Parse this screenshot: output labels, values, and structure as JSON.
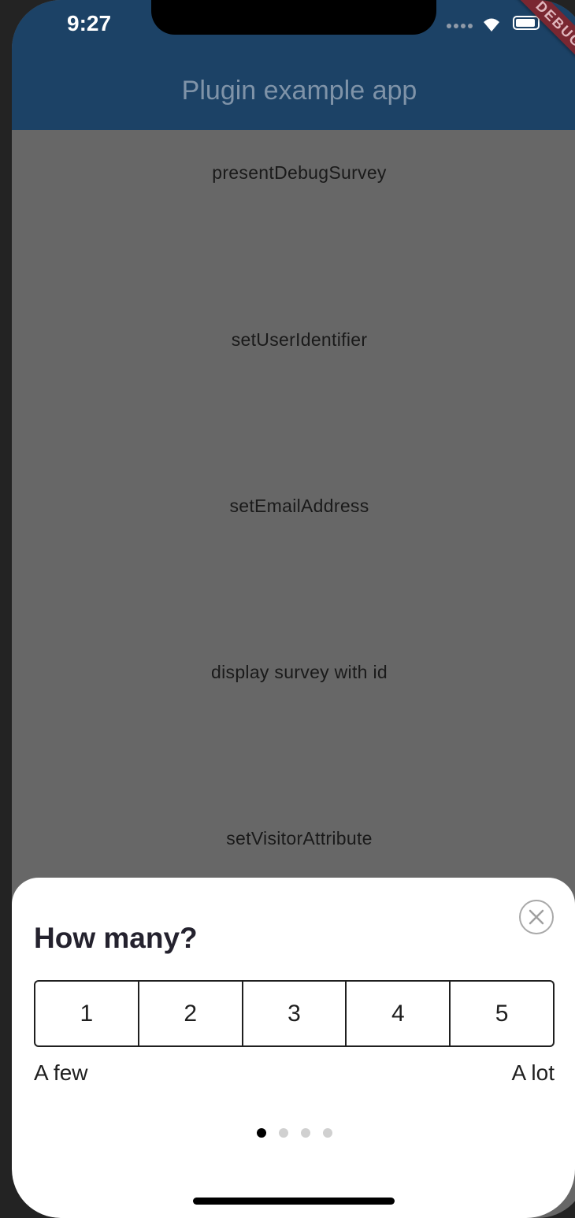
{
  "status_bar": {
    "time": "9:27"
  },
  "debug_banner": "DEBUG",
  "app_bar": {
    "title": "Plugin example app"
  },
  "menu_items": [
    "presentDebugSurvey",
    "setUserIdentifier",
    "setEmailAddress",
    "display survey with id",
    "setVisitorAttribute"
  ],
  "survey": {
    "question": "How many?",
    "options": [
      "1",
      "2",
      "3",
      "4",
      "5"
    ],
    "min_label": "A few",
    "max_label": "A lot",
    "page_index": 1,
    "page_count": 4
  },
  "colors": {
    "app_bar": "#1c4266",
    "scrim": "#676767",
    "sheet": "#ffffff"
  }
}
